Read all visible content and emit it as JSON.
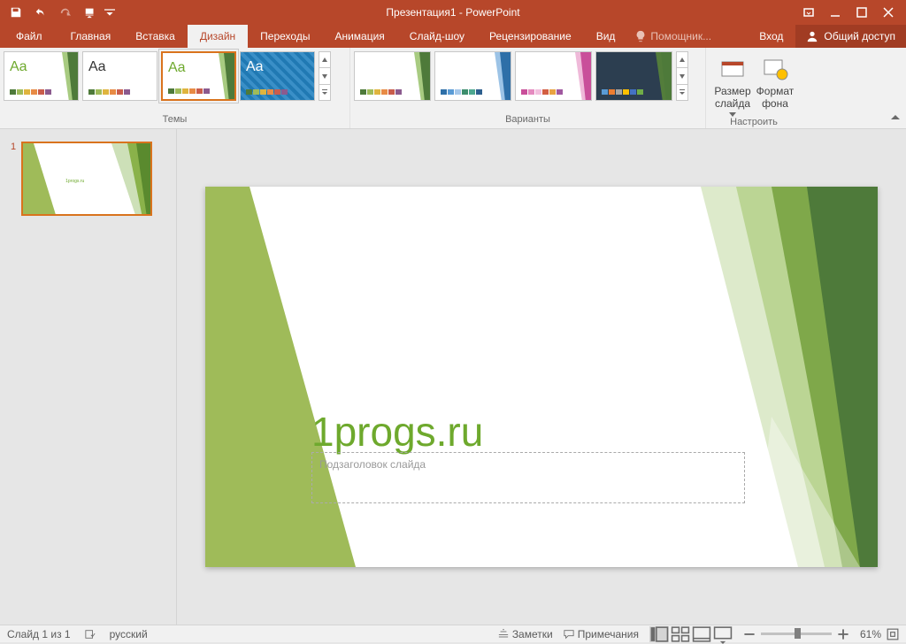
{
  "title": "Презентация1 - PowerPoint",
  "tabs": {
    "file": "Файл",
    "home": "Главная",
    "insert": "Вставка",
    "design": "Дизайн",
    "transitions": "Переходы",
    "animation": "Анимация",
    "slideshow": "Слайд-шоу",
    "review": "Рецензирование",
    "view": "Вид"
  },
  "tellme": "Помощник...",
  "signin": "Вход",
  "share": "Общий доступ",
  "ribbon": {
    "themes_label": "Темы",
    "variants_label": "Варианты",
    "customize_label": "Настроить",
    "slide_size": "Размер слайда",
    "format_bg": "Формат фона"
  },
  "slide": {
    "number": "1",
    "title_text": "1progs.ru",
    "subtitle_placeholder": "Подзаголовок слайда"
  },
  "status": {
    "slide_count": "Слайд 1 из 1",
    "language": "русский",
    "notes": "Заметки",
    "comments": "Примечания",
    "zoom": "61%"
  },
  "theme_aa": {
    "green": "Aa",
    "black": "Aa",
    "sel": "Aa",
    "pattern": "Aa"
  }
}
